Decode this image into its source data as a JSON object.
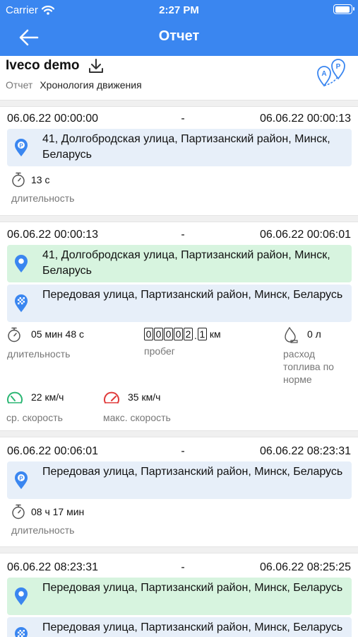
{
  "status_bar": {
    "carrier": "Carrier",
    "time": "2:27 PM"
  },
  "nav": {
    "title": "Отчет"
  },
  "header": {
    "unit_name": "Iveco demo",
    "report_key": "Отчет",
    "report_value": "Хронология движения"
  },
  "labels": {
    "duration": "длительность",
    "mileage": "пробег",
    "fuel": "расход топлива по норме",
    "avg_speed": "ср. скорость",
    "max_speed": "макс. скорость",
    "dash": "-"
  },
  "entries": [
    {
      "start": "06.06.22 00:00:00",
      "end": "06.06.22 00:00:13",
      "address_1": "41, Долгобродская улица, Партизанский район, Минск, Беларусь",
      "duration": "13 с"
    },
    {
      "start": "06.06.22 00:00:13",
      "end": "06.06.22 00:06:01",
      "address_1": "41, Долгобродская улица, Партизанский район, Минск, Беларусь",
      "address_2": "Передовая улица, Партизанский район, Минск, Беларусь",
      "duration": "05 мин 48 с",
      "mileage_digits": [
        "0",
        "0",
        "0",
        "0",
        "2"
      ],
      "mileage_decimal": "1",
      "mileage_unit": "км",
      "fuel": "0 л",
      "avg_speed": "22 км/ч",
      "max_speed": "35 км/ч"
    },
    {
      "start": "06.06.22 00:06:01",
      "end": "06.06.22 08:23:31",
      "address_1": "Передовая улица, Партизанский район, Минск, Беларусь",
      "duration": "08 ч 17 мин"
    },
    {
      "start": "06.06.22 08:23:31",
      "end": "06.06.22 08:25:25",
      "address_1": "Передовая улица, Партизанский район, Минск, Беларусь",
      "address_2": "Передовая улица, Партизанский район, Минск, Беларусь"
    }
  ],
  "colors": {
    "primary": "#3a86f0",
    "parking_bg": "#e7eff9",
    "start_bg": "#d7f4df",
    "avg_speed": "#2bb673",
    "max_speed": "#e03b3b"
  },
  "icons": [
    "back-arrow-icon",
    "download-icon",
    "route-icon",
    "parking-pin-icon",
    "location-pin-icon",
    "finish-pin-icon",
    "stopwatch-icon",
    "fuel-drop-icon",
    "speedometer-icon",
    "wifi-icon",
    "battery-icon"
  ]
}
